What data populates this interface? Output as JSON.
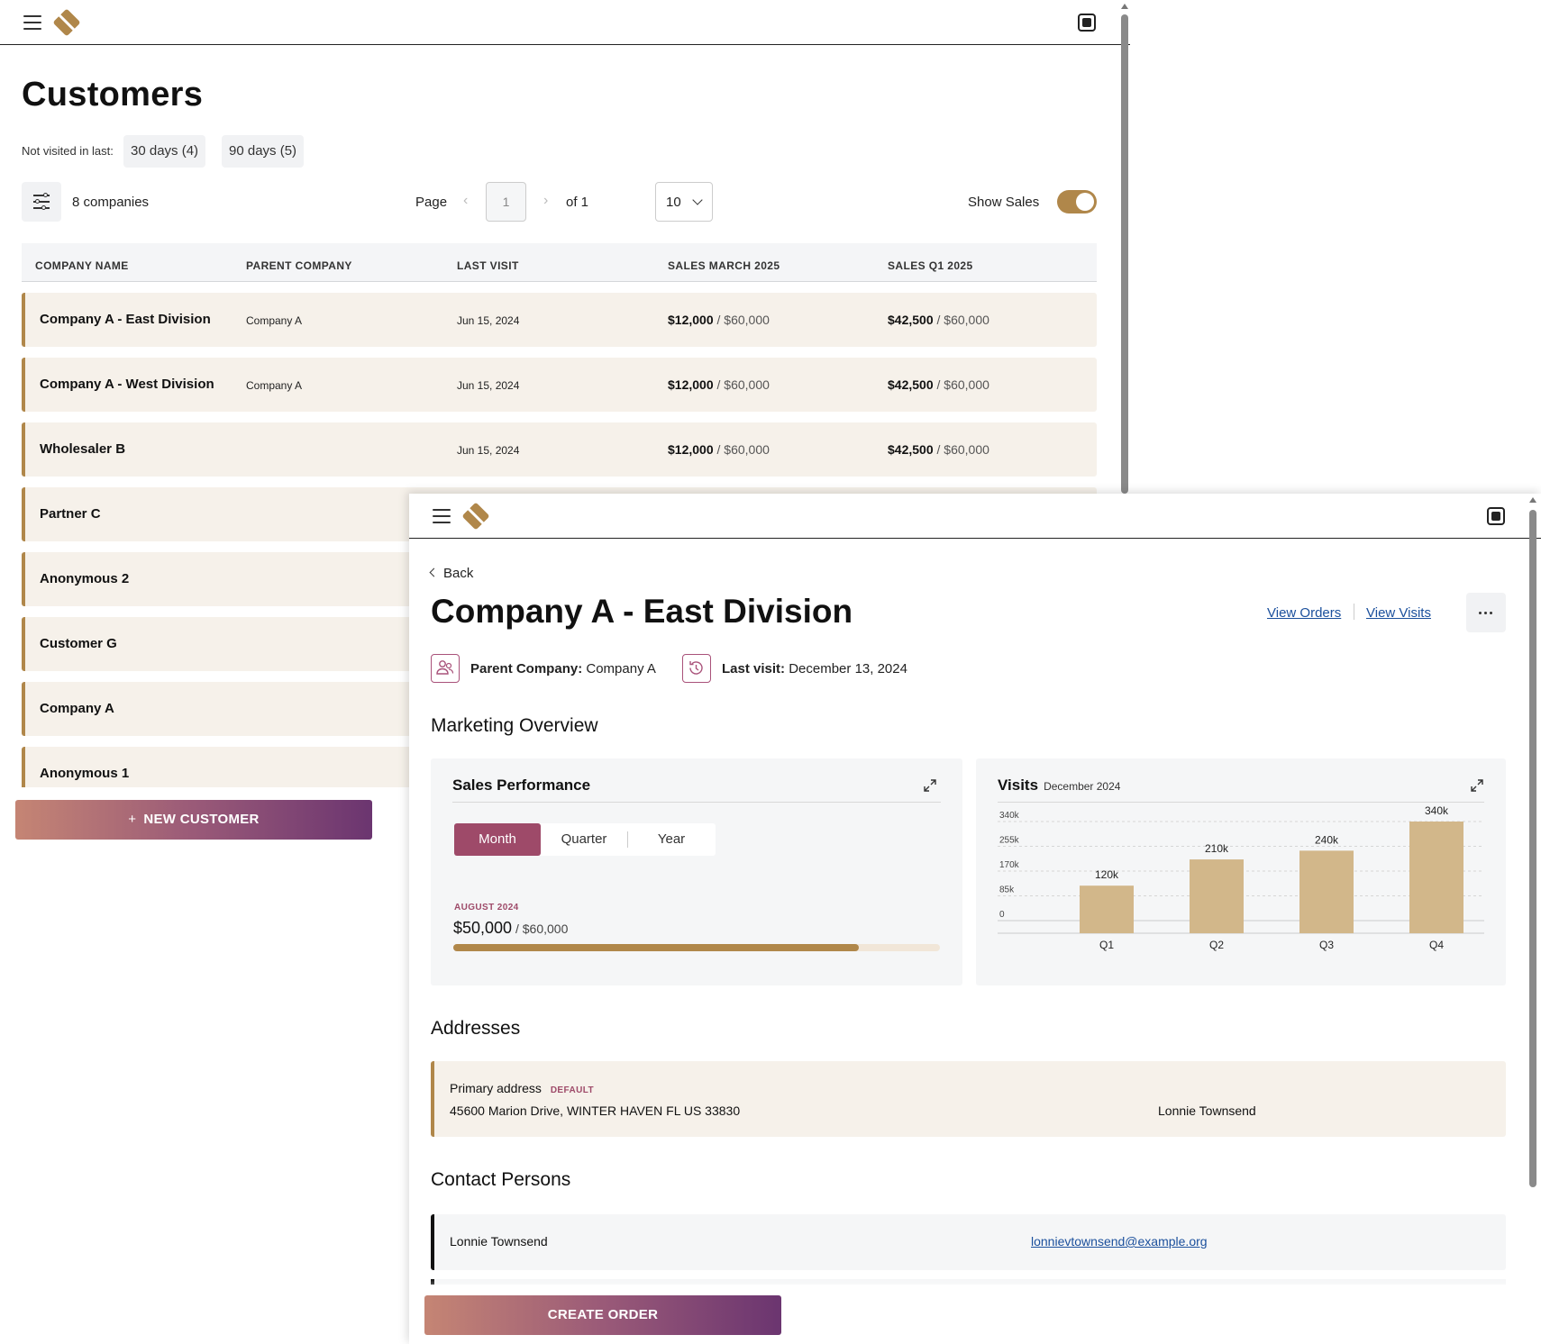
{
  "customers_window": {
    "title": "Customers",
    "not_visited_label": "Not visited in last:",
    "chips": [
      {
        "label": "30 days (4)"
      },
      {
        "label": "90 days (5)"
      }
    ],
    "company_count": "8 companies",
    "pagination": {
      "page_label": "Page",
      "prev": "‹",
      "next": "›",
      "current_page": "1",
      "of_label": "of 1",
      "page_size": "10"
    },
    "show_sales_label": "Show Sales",
    "show_sales_on": true,
    "columns": [
      "COMPANY NAME",
      "PARENT COMPANY",
      "LAST VISIT",
      "SALES MARCH 2025",
      "SALES Q1 2025"
    ],
    "rows": [
      {
        "name": "Company A - East Division",
        "parent": "Company A",
        "last_visit": "Jun 15, 2024",
        "sales_march": "$12,000",
        "sales_march_of": " / $60,000",
        "sales_q1": "$42,500",
        "sales_q1_of": " / $60,000"
      },
      {
        "name": "Company A - West Division",
        "parent": "Company A",
        "last_visit": "Jun 15, 2024",
        "sales_march": "$12,000",
        "sales_march_of": " / $60,000",
        "sales_q1": "$42,500",
        "sales_q1_of": " / $60,000"
      },
      {
        "name": "Wholesaler B",
        "parent": "",
        "last_visit": "Jun 15, 2024",
        "sales_march": "$12,000",
        "sales_march_of": " / $60,000",
        "sales_q1": "$42,500",
        "sales_q1_of": " / $60,000"
      },
      {
        "name": "Partner C"
      },
      {
        "name": "Anonymous 2"
      },
      {
        "name": "Customer G"
      },
      {
        "name": "Company A"
      },
      {
        "name": "Anonymous 1"
      }
    ],
    "new_customer_label": "NEW CUSTOMER"
  },
  "detail_window": {
    "back_label": "Back",
    "company_title": "Company A - East Division",
    "view_orders": "View Orders",
    "view_visits": "View Visits",
    "parent_label": "Parent Company:",
    "parent_value": "Company A",
    "last_visit_label": "Last visit:",
    "last_visit_value": "December 13, 2024",
    "marketing_heading": "Marketing Overview",
    "sales_performance": {
      "title": "Sales Performance",
      "tabs": [
        "Month",
        "Quarter",
        "Year"
      ],
      "active_tab": "Month",
      "period": "AUGUST 2024",
      "amount": "$50,000",
      "amount_of": " / $60,000",
      "progress": 0.833
    },
    "visits": {
      "title": "Visits",
      "subtitle": "December 2024"
    },
    "chart_data": {
      "type": "bar",
      "title": "Visits",
      "subtitle": "December 2024",
      "categories": [
        "Q1",
        "Q2",
        "Q3",
        "Q4"
      ],
      "values": [
        120000,
        210000,
        240000,
        340000
      ],
      "value_labels": [
        "120k",
        "210k",
        "240k",
        "340k"
      ],
      "y_ticks": [
        "0",
        "85k",
        "170k",
        "255k",
        "340k"
      ],
      "ylim": [
        0,
        340000
      ],
      "grid": true,
      "bar_color": "#d2b78a"
    },
    "addresses_heading": "Addresses",
    "address": {
      "title": "Primary address",
      "badge": "DEFAULT",
      "line": "45600 Marion Drive, WINTER HAVEN FL US 33830",
      "contact": "Lonnie Townsend"
    },
    "contacts_heading": "Contact Persons",
    "contact": {
      "name": "Lonnie Townsend",
      "email": "lonnievtownsend@example.org"
    },
    "create_order_label": "CREATE ORDER"
  },
  "colors": {
    "accent_gold": "#b0874a",
    "accent_plum": "#9e4a69",
    "row_bg": "#f6f1ea",
    "link": "#1a4f9c"
  },
  "icons": [
    "hamburger-icon",
    "logo-icon",
    "window-switch-icon",
    "filter-icon",
    "chevron-down-icon",
    "chevron-left-icon",
    "plus-icon",
    "people-icon",
    "history-icon",
    "expand-icon",
    "more-icon"
  ]
}
